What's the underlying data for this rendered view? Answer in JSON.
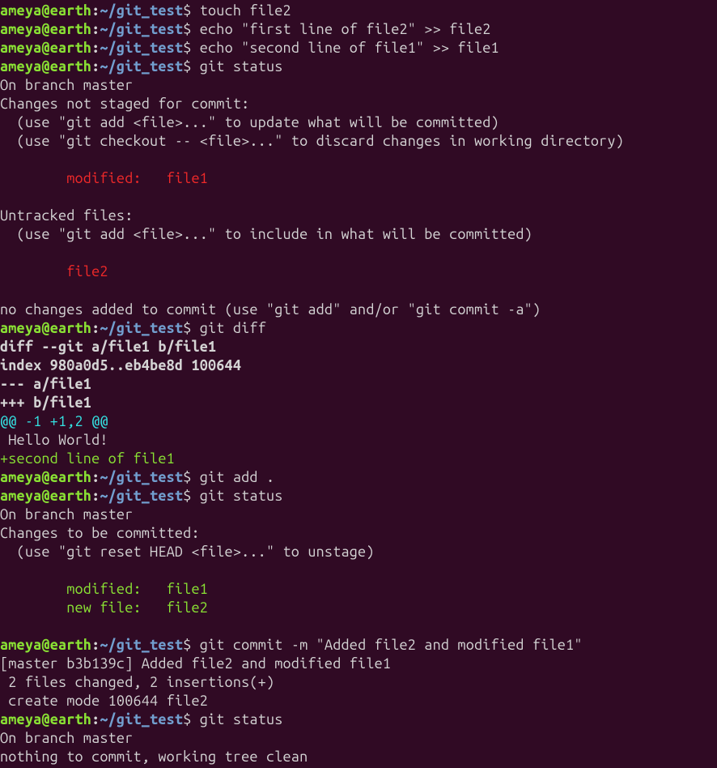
{
  "prompt": {
    "user": "ameya",
    "at": "@",
    "host": "earth",
    "colon": ":",
    "path": "~/git_test",
    "dollar": "$ "
  },
  "lines": [
    {
      "type": "prompt",
      "cmd": "touch file2"
    },
    {
      "type": "prompt",
      "cmd": "echo \"first line of file2\" >> file2"
    },
    {
      "type": "prompt",
      "cmd": "echo \"second line of file1\" >> file1"
    },
    {
      "type": "prompt",
      "cmd": "git status"
    },
    {
      "type": "out",
      "text": "On branch master"
    },
    {
      "type": "out",
      "text": "Changes not staged for commit:"
    },
    {
      "type": "out",
      "text": "  (use \"git add <file>...\" to update what will be committed)"
    },
    {
      "type": "out",
      "text": "  (use \"git checkout -- <file>...\" to discard changes in working directory)"
    },
    {
      "type": "out",
      "text": ""
    },
    {
      "type": "red",
      "text": "        modified:   file1"
    },
    {
      "type": "out",
      "text": ""
    },
    {
      "type": "out",
      "text": "Untracked files:"
    },
    {
      "type": "out",
      "text": "  (use \"git add <file>...\" to include in what will be committed)"
    },
    {
      "type": "out",
      "text": ""
    },
    {
      "type": "red",
      "text": "        file2"
    },
    {
      "type": "out",
      "text": ""
    },
    {
      "type": "out",
      "text": "no changes added to commit (use \"git add\" and/or \"git commit -a\")"
    },
    {
      "type": "prompt",
      "cmd": "git diff"
    },
    {
      "type": "bold",
      "text": "diff --git a/file1 b/file1"
    },
    {
      "type": "bold",
      "text": "index 980a0d5..eb4be8d 100644"
    },
    {
      "type": "bold",
      "text": "--- a/file1"
    },
    {
      "type": "bold",
      "text": "+++ b/file1"
    },
    {
      "type": "cyan",
      "text": "@@ -1 +1,2 @@"
    },
    {
      "type": "out",
      "text": " Hello World!"
    },
    {
      "type": "green",
      "text": "+second line of file1"
    },
    {
      "type": "prompt",
      "cmd": "git add ."
    },
    {
      "type": "prompt",
      "cmd": "git status"
    },
    {
      "type": "out",
      "text": "On branch master"
    },
    {
      "type": "out",
      "text": "Changes to be committed:"
    },
    {
      "type": "out",
      "text": "  (use \"git reset HEAD <file>...\" to unstage)"
    },
    {
      "type": "out",
      "text": ""
    },
    {
      "type": "green",
      "text": "        modified:   file1"
    },
    {
      "type": "green",
      "text": "        new file:   file2"
    },
    {
      "type": "out",
      "text": ""
    },
    {
      "type": "prompt",
      "cmd": "git commit -m \"Added file2 and modified file1\""
    },
    {
      "type": "out",
      "text": "[master b3b139c] Added file2 and modified file1"
    },
    {
      "type": "out",
      "text": " 2 files changed, 2 insertions(+)"
    },
    {
      "type": "out",
      "text": " create mode 100644 file2"
    },
    {
      "type": "prompt",
      "cmd": "git status"
    },
    {
      "type": "out",
      "text": "On branch master"
    },
    {
      "type": "out",
      "text": "nothing to commit, working tree clean"
    }
  ]
}
